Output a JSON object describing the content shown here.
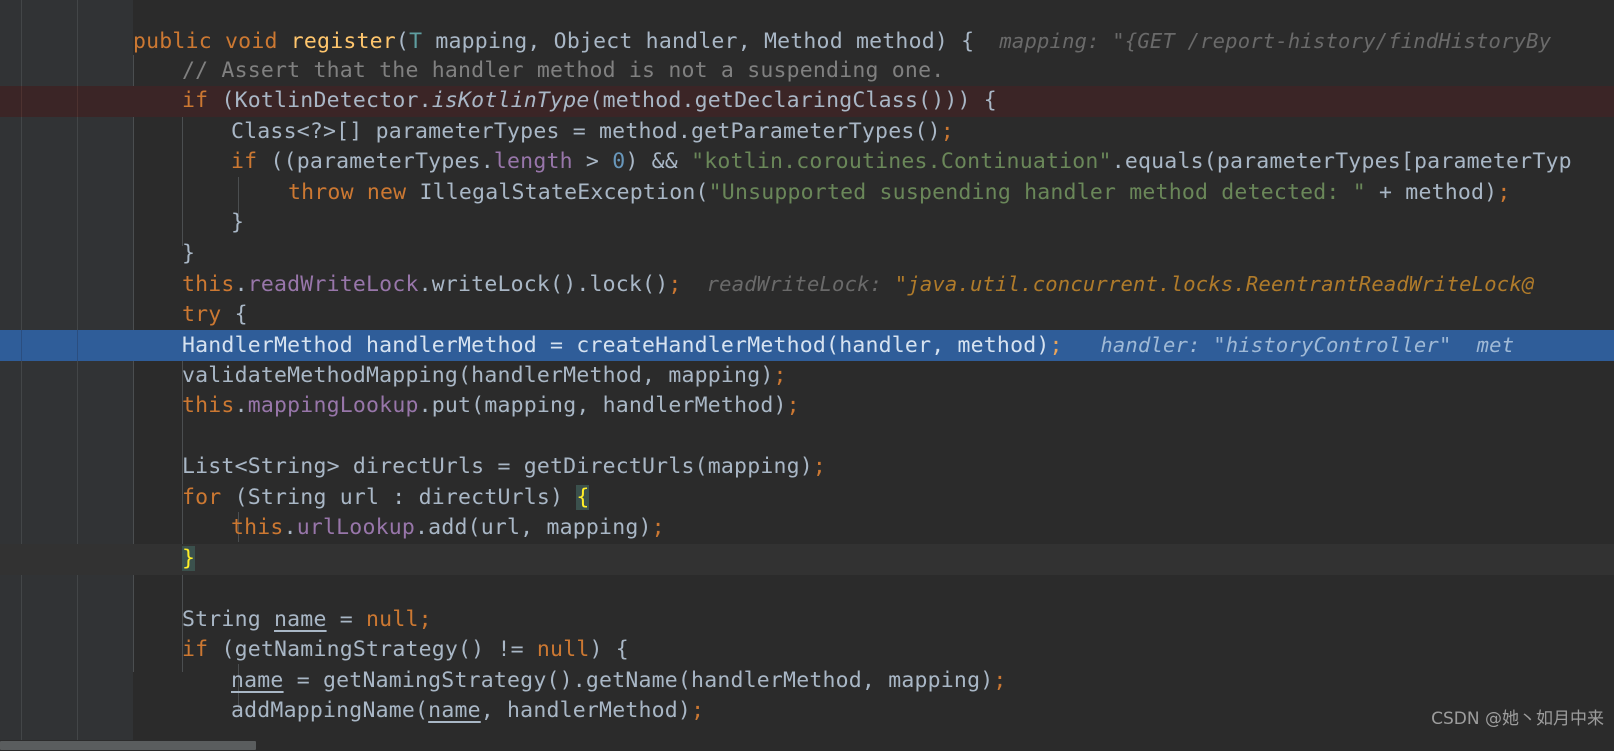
{
  "editor": {
    "language": "java",
    "theme": "darcula",
    "background": "#2b2b2b",
    "gutter_background": "#313335",
    "selection_color": "#2f5d99",
    "error_line_color": "#3b2526",
    "brace_match_color": "#3b514d"
  },
  "watermark": {
    "text": "CSDN @她丶如月中来"
  },
  "code": {
    "l1": {
      "t1": "public",
      "t2": " ",
      "t3": "void",
      "t4": " ",
      "t5": "register",
      "t6": "(",
      "t7": "T",
      "t8": " mapping, Object handler, Method method) {",
      "hint_label": "mapping:",
      "hint_value": "\"{GET /report-history/findHistoryBy"
    },
    "l2": {
      "comment": "// Assert that the handler method is not a suspending one."
    },
    "l3": {
      "kw": "if",
      "a": " (KotlinDetector.",
      "m": "isKotlinType",
      "b": "(method.getDeclaringClass())) {"
    },
    "l4": {
      "a": "Class<?>[] parameterTypes = method.getParameterTypes()",
      "semi": ";"
    },
    "l5": {
      "kw": "if",
      "a": " ((parameterTypes.",
      "field": "length",
      "b": " > ",
      "num": "0",
      "c": ") && ",
      "str": "\"kotlin.coroutines.Continuation\"",
      "d": ".equals(parameterTypes[parameterTyp"
    },
    "l6": {
      "kw1": "throw",
      "sp1": " ",
      "kw2": "new",
      "sp2": " ",
      "a": "IllegalStateException(",
      "str": "\"Unsupported suspending handler method detected: \"",
      "b": " + method)",
      "semi": ";"
    },
    "l7": {
      "brace": "}"
    },
    "l8": {
      "brace": "}"
    },
    "l9": {
      "kw": "this",
      "a": ".",
      "field": "readWriteLock",
      "b": ".writeLock().lock()",
      "semi": ";",
      "hint_label": "readWriteLock:",
      "hint_value": "\"java.util.concurrent.locks.ReentrantReadWriteLock@"
    },
    "l10": {
      "kw": "try",
      "a": " {"
    },
    "l11": {
      "a": "HandlerMethod handlerMethod = createHandlerMethod(handler, method)",
      "semi": ";",
      "hint_label": "handler:",
      "hint_value": "\"historyController\"",
      "hint_label2": "met"
    },
    "l12": {
      "a": "validateMethodMapping(handlerMethod, mapping)",
      "semi": ";"
    },
    "l13": {
      "kw": "this",
      "a": ".",
      "field": "mappingLookup",
      "b": ".put(mapping, handlerMethod)",
      "semi": ";"
    },
    "l14": {
      "a": ""
    },
    "l15": {
      "a": "List<String> directUrls = getDirectUrls(mapping)",
      "semi": ";"
    },
    "l16": {
      "kw": "for",
      "a": " (String url : directUrls) ",
      "brace": "{"
    },
    "l17": {
      "kw": "this",
      "a": ".",
      "field": "urlLookup",
      "b": ".add(url, mapping)",
      "semi": ";"
    },
    "l18": {
      "brace": "}"
    },
    "l19": {
      "a": ""
    },
    "l20": {
      "a": "String ",
      "var": "name",
      "b": " = ",
      "kw": "null",
      "semi": ";"
    },
    "l21": {
      "kw": "if",
      "a": " (getNamingStrategy() != ",
      "kw2": "null",
      "b": ") {"
    },
    "l22": {
      "var": "name",
      "a": " = getNamingStrategy().getName(handlerMethod, mapping)",
      "semi": ";"
    },
    "l23": {
      "a": "addMappingName(",
      "var": "name",
      "b": ", handlerMethod)",
      "semi": ";"
    }
  }
}
